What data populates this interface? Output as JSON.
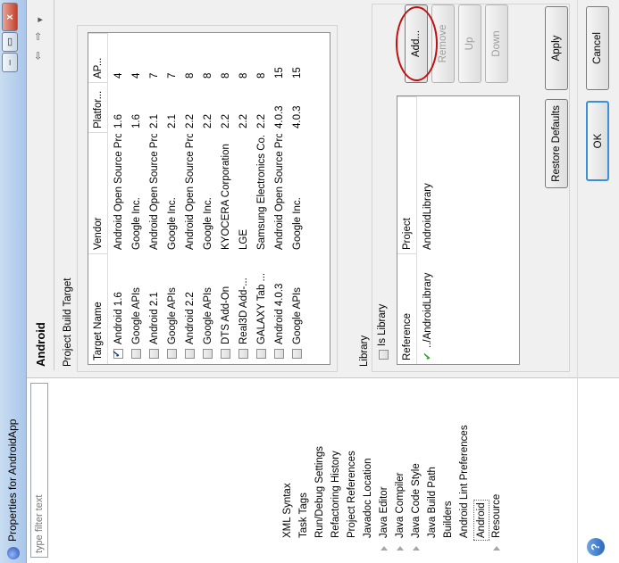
{
  "window": {
    "title": "Properties for AndroidApp",
    "close_glyph": "x",
    "restore_glyph": "▭",
    "minimize_glyph": "–"
  },
  "tree": {
    "filter_placeholder": "type filter text",
    "items": [
      {
        "label": "Resource",
        "expandable": true
      },
      {
        "label": "Android",
        "expandable": false
      },
      {
        "label": "Android Lint Preferences",
        "expandable": false
      },
      {
        "label": "Builders",
        "expandable": false
      },
      {
        "label": "Java Build Path",
        "expandable": false
      },
      {
        "label": "Java Code Style",
        "expandable": true
      },
      {
        "label": "Java Compiler",
        "expandable": true
      },
      {
        "label": "Java Editor",
        "expandable": true
      },
      {
        "label": "Javadoc Location",
        "expandable": false
      },
      {
        "label": "Project References",
        "expandable": false
      },
      {
        "label": "Refactoring History",
        "expandable": false
      },
      {
        "label": "Run/Debug Settings",
        "expandable": false
      },
      {
        "label": "Task Tags",
        "expandable": false
      },
      {
        "label": "XML Syntax",
        "expandable": false
      }
    ]
  },
  "panel": {
    "title": "Android",
    "nav": {
      "menu": "▾",
      "back": "⇦",
      "forward": "⇨"
    },
    "build_target": {
      "group_label": "Project Build Target",
      "columns": [
        "Target Name",
        "Vendor",
        "Platfor...",
        "AP..."
      ],
      "rows": [
        {
          "checked": true,
          "name": "Android 1.6",
          "vendor": "Android Open Source Project",
          "platform": "1.6",
          "api": "4"
        },
        {
          "checked": false,
          "name": "Google APIs",
          "vendor": "Google Inc.",
          "platform": "1.6",
          "api": "4"
        },
        {
          "checked": false,
          "name": "Android 2.1",
          "vendor": "Android Open Source Project",
          "platform": "2.1",
          "api": "7"
        },
        {
          "checked": false,
          "name": "Google APIs",
          "vendor": "Google Inc.",
          "platform": "2.1",
          "api": "7"
        },
        {
          "checked": false,
          "name": "Android 2.2",
          "vendor": "Android Open Source Project",
          "platform": "2.2",
          "api": "8"
        },
        {
          "checked": false,
          "name": "Google APIs",
          "vendor": "Google Inc.",
          "platform": "2.2",
          "api": "8"
        },
        {
          "checked": false,
          "name": "DTS Add-On",
          "vendor": "KYOCERA Corporation",
          "platform": "2.2",
          "api": "8"
        },
        {
          "checked": false,
          "name": "Real3D Add-...",
          "vendor": "LGE",
          "platform": "2.2",
          "api": "8"
        },
        {
          "checked": false,
          "name": "GALAXY Tab ...",
          "vendor": "Samsung Electronics Co., Lt...",
          "platform": "2.2",
          "api": "8"
        },
        {
          "checked": false,
          "name": "Android 4.0.3",
          "vendor": "Android Open Source Project",
          "platform": "4.0.3",
          "api": "15"
        },
        {
          "checked": false,
          "name": "Google APIs",
          "vendor": "Google Inc.",
          "platform": "4.0.3",
          "api": "15"
        }
      ]
    },
    "library": {
      "group_label": "Library",
      "is_library_label": "Is Library",
      "is_library_checked": false,
      "columns": [
        "Reference",
        "Project"
      ],
      "rows": [
        {
          "reference": "../AndroidLibrary",
          "project": "AndroidLibrary",
          "valid": true
        }
      ],
      "buttons": {
        "add": "Add...",
        "remove": "Remove",
        "up": "Up",
        "down": "Down"
      }
    }
  },
  "footer": {
    "restore_defaults": "Restore Defaults",
    "apply": "Apply",
    "ok": "OK",
    "cancel": "Cancel",
    "help": "?"
  },
  "colors": {
    "annotation": "#c01010",
    "ok_focus": "#3b8fd9",
    "check": "#2aa52a"
  }
}
